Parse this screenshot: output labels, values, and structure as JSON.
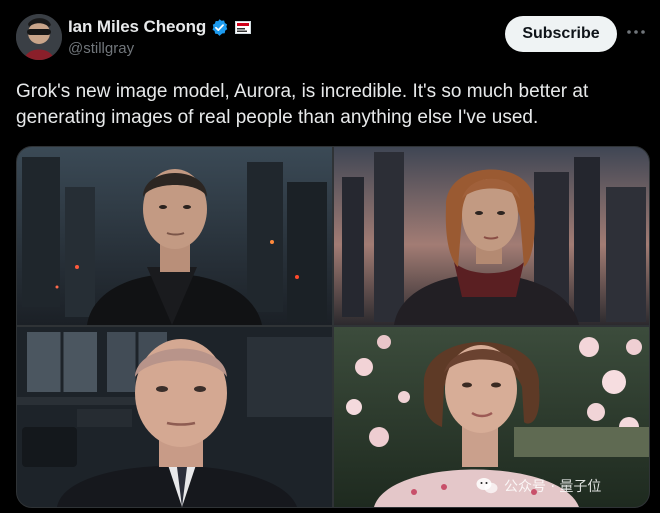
{
  "author": {
    "display_name": "Ian Miles Cheong",
    "handle": "@stillgray",
    "avatar_icon": "user-avatar",
    "verified_icon": "verified-badge-icon",
    "affiliation_icon": "affiliate-badge-icon"
  },
  "actions": {
    "subscribe_label": "Subscribe",
    "more_icon": "more-options-icon"
  },
  "post": {
    "text": "Grok's new image model, Aurora, is incredible. It's so much better at generating images of real people than anything else I've used."
  },
  "media": {
    "images": [
      {
        "subject": "man-dark-coat-city-night"
      },
      {
        "subject": "red-haired-woman-city-dusk"
      },
      {
        "subject": "man-suit-office"
      },
      {
        "subject": "woman-floral-garden"
      }
    ]
  },
  "watermark": {
    "text": "公众号 · 量子位"
  },
  "colors": {
    "background": "#000000",
    "text_primary": "#e7e9ea",
    "text_secondary": "#71767b",
    "verified_blue": "#1d9bf0",
    "button_bg": "#eff3f4"
  }
}
